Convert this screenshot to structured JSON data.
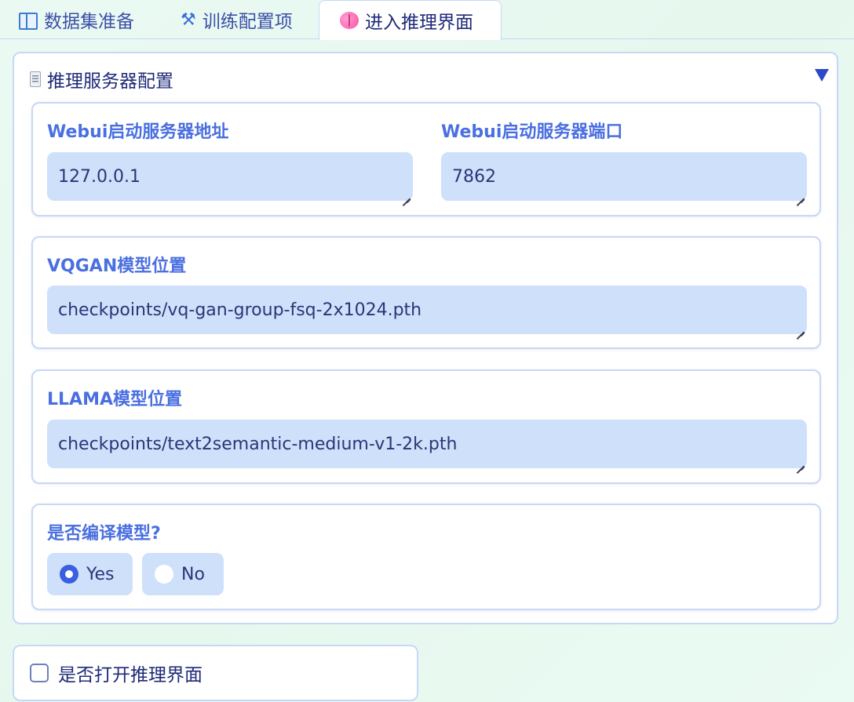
{
  "tabs": [
    {
      "label": "数据集准备",
      "icon": "book-icon"
    },
    {
      "label": "训练配置项",
      "icon": "tools-icon"
    },
    {
      "label": "进入推理界面",
      "icon": "brain-icon",
      "active": true
    }
  ],
  "inference_panel": {
    "title": "推理服务器配置",
    "collapse_icon": "caret-down-icon",
    "server_address": {
      "label": "Webui启动服务器地址",
      "value": "127.0.0.1"
    },
    "server_port": {
      "label": "Webui启动服务器端口",
      "value": "7862"
    },
    "vqgan_path": {
      "label": "VQGAN模型位置",
      "value": "checkpoints/vq-gan-group-fsq-2x1024.pth"
    },
    "llama_path": {
      "label": "LLAMA模型位置",
      "value": "checkpoints/text2semantic-medium-v1-2k.pth"
    },
    "compile": {
      "label": "是否编译模型?",
      "options": [
        "Yes",
        "No"
      ],
      "selected": "Yes"
    }
  },
  "open_inference": {
    "label": "是否打开推理界面",
    "checked": false
  },
  "colors": {
    "accent": "#3a5fe0",
    "label": "#4a6fe0",
    "field_bg": "#cfe0fb",
    "border": "#c6d8f6"
  }
}
